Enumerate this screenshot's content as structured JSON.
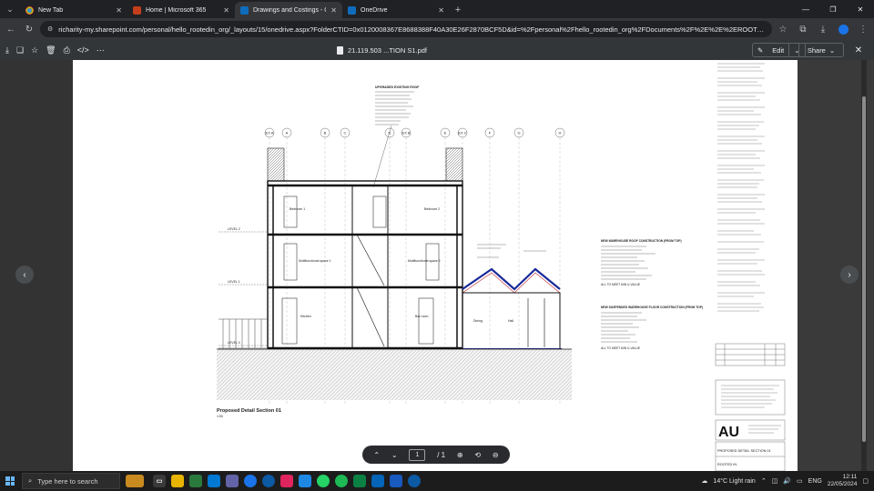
{
  "browser": {
    "tabs": [
      {
        "label": "New Tab",
        "icon": "chrome-icon",
        "active": false
      },
      {
        "label": "Home | Microsoft 365",
        "icon": "microsoft365-icon",
        "active": false
      },
      {
        "label": "Drawings and Costings - OneDri",
        "icon": "onedrive-icon",
        "active": true
      },
      {
        "label": "OneDrive",
        "icon": "onedrive-icon",
        "active": false
      }
    ],
    "url": "richarity-my.sharepoint.com/personal/hello_rootedin_org/_layouts/15/onedrive.aspx?FolderCTID=0x0120008367E8688388F40A30E26F2870BCF5D&id=%2Fpersonal%2Fhello_rootedin_org%2FDocuments%2F%2E%2E%2EROOTED%20IN%20HOMES%20..."
  },
  "pdf_toolbar": {
    "file_name": "21.119.503 ...TION S1.pdf",
    "edit_label": "Edit",
    "share_label": "Share"
  },
  "drawing": {
    "title": "Proposed Detail Section 01",
    "scale_note": "1:50",
    "grid_labels": [
      "EX A",
      "A",
      "B",
      "C",
      "D",
      "EX B",
      "E",
      "EX C",
      "F",
      "G",
      "H"
    ],
    "level_labels": [
      "LEVEL 2",
      "LEVEL 1",
      "LEVEL 0"
    ],
    "roof_note_title": "UPGRADED EXISTING ROOF",
    "room_labels": [
      "Bedroom 1",
      "Bedroom 2",
      "Multifunctional space 1",
      "Multifunctional space 2",
      "Kitchen",
      "Bar room",
      "Hall",
      "Dining"
    ],
    "window_roof_note": "NEW WAREHOUSE ROOF CONSTRUCTION (FROM TOP)",
    "floor_note": "NEW SUSPENDED WAREHOUSE FLOOR CONSTRUCTION (FROM TOP)",
    "to_meet_note": "ALL TO MEET MIN U-VALUE",
    "title_block": {
      "logo": "AU",
      "drawing_title": "PROPOSED DETAIL SECTION 01",
      "client": "ROOTED IN"
    }
  },
  "pager": {
    "current_page": "1",
    "total_pages": "/ 1"
  },
  "taskbar": {
    "search_placeholder": "Type here to search",
    "weather": "14°C  Light rain",
    "language": "ENG",
    "time": "12:11",
    "date": "22/05/2024"
  }
}
